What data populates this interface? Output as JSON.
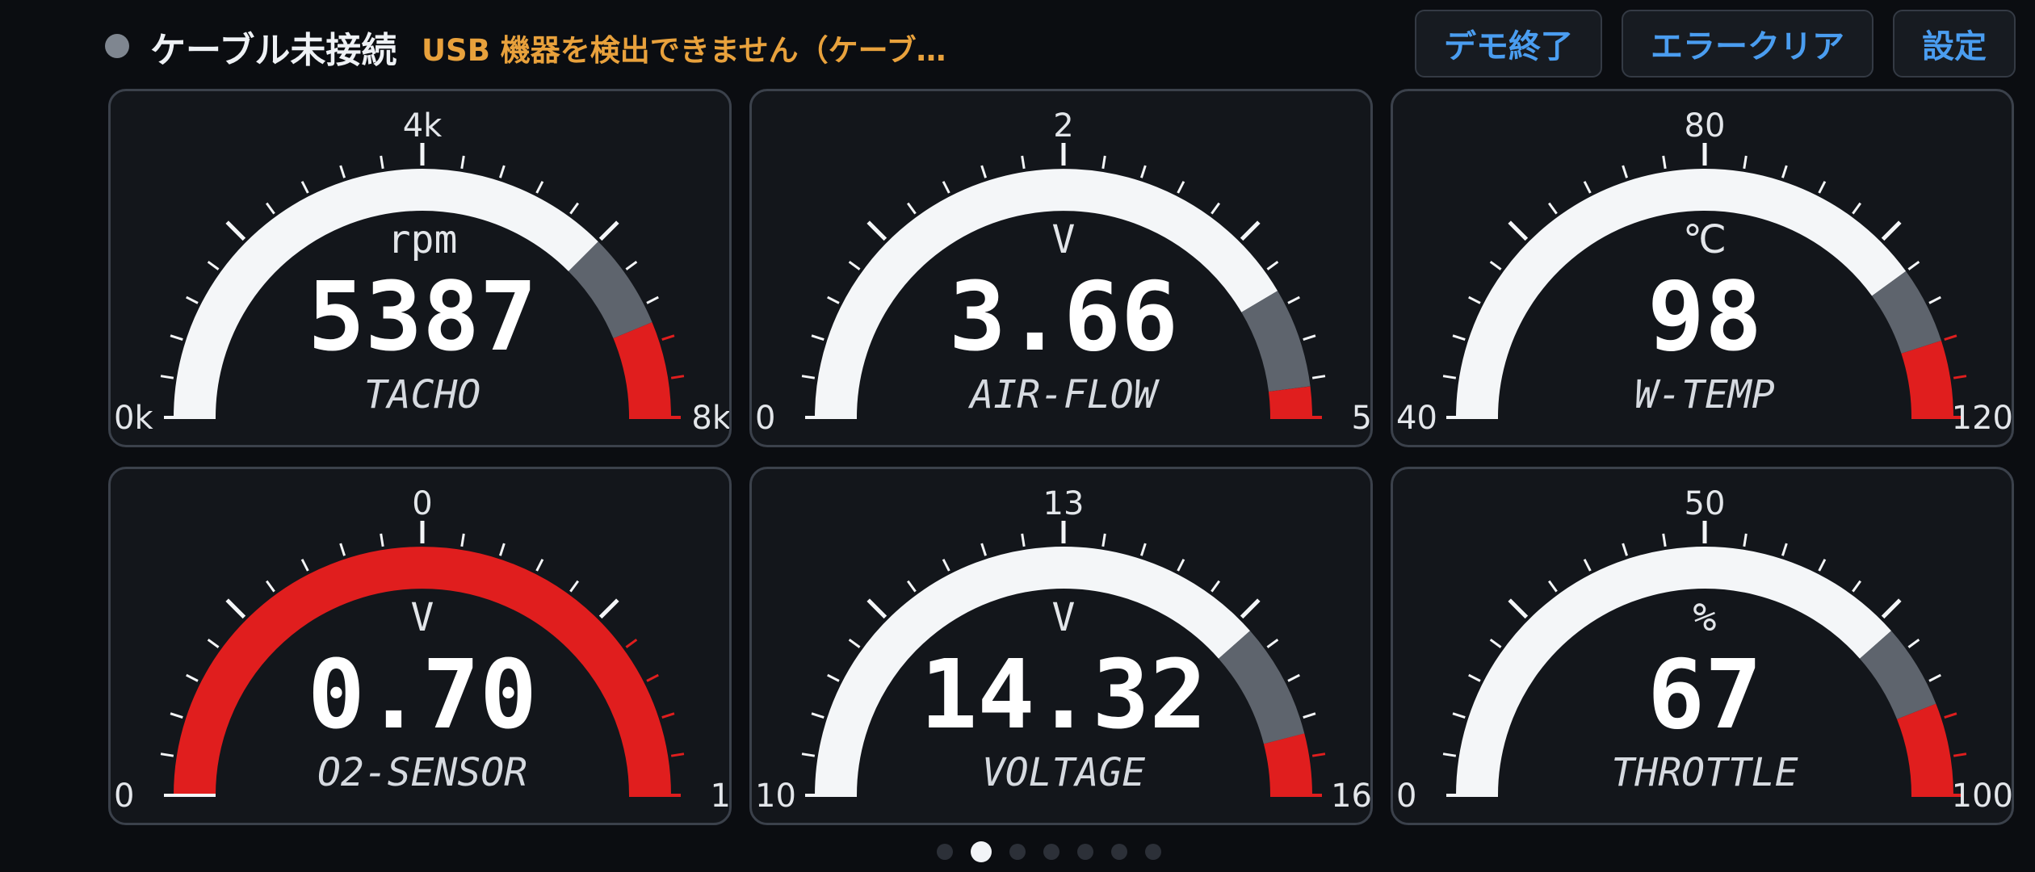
{
  "status": {
    "text": "ケーブル未接続",
    "message": "USB 機器を検出できません（ケーブ…",
    "dot_color": "#7f8690",
    "message_color": "#e8a13c"
  },
  "buttons": {
    "demo_end": "デモ終了",
    "error_clear": "エラークリア",
    "settings": "設定"
  },
  "colors": {
    "arc_normal": "#f4f6f8",
    "arc_warning": "#5e646d",
    "arc_danger": "#e01e1e",
    "button_text": "#4a9df0"
  },
  "gauges": [
    {
      "name": "TACHO",
      "unit": "rpm",
      "value": "5387",
      "min_label": "0k",
      "mid_label": "4k",
      "max_label": "8k",
      "min": 0,
      "max": 8000,
      "warn_start": 0.75,
      "danger_start": 0.875,
      "all_red": false
    },
    {
      "name": "AIR-FLOW",
      "unit": "V",
      "value": "3.66",
      "min_label": "0",
      "mid_label": "2",
      "max_label": "5",
      "min": 0,
      "max": 5,
      "warn_start": 0.83,
      "danger_start": 0.96,
      "all_red": false
    },
    {
      "name": "W-TEMP",
      "unit": "℃",
      "value": "98",
      "min_label": "40",
      "mid_label": "80",
      "max_label": "120",
      "min": 40,
      "max": 120,
      "warn_start": 0.8,
      "danger_start": 0.9,
      "all_red": false
    },
    {
      "name": "O2-SENSOR",
      "unit": "V",
      "value": "0.70",
      "min_label": "0",
      "mid_label": "0",
      "max_label": "1",
      "min": 0,
      "max": 1,
      "warn_start": 0.8,
      "danger_start": 0.9,
      "all_red": true
    },
    {
      "name": "VOLTAGE",
      "unit": "V",
      "value": "14.32",
      "min_label": "10",
      "mid_label": "13",
      "max_label": "16",
      "min": 10,
      "max": 16,
      "warn_start": 0.77,
      "danger_start": 0.92,
      "all_red": false
    },
    {
      "name": "THROTTLE",
      "unit": "%",
      "value": "67",
      "min_label": "0",
      "mid_label": "50",
      "max_label": "100",
      "min": 0,
      "max": 100,
      "warn_start": 0.77,
      "danger_start": 0.88,
      "all_red": false
    }
  ],
  "pager": {
    "count": 7,
    "active": 1
  }
}
